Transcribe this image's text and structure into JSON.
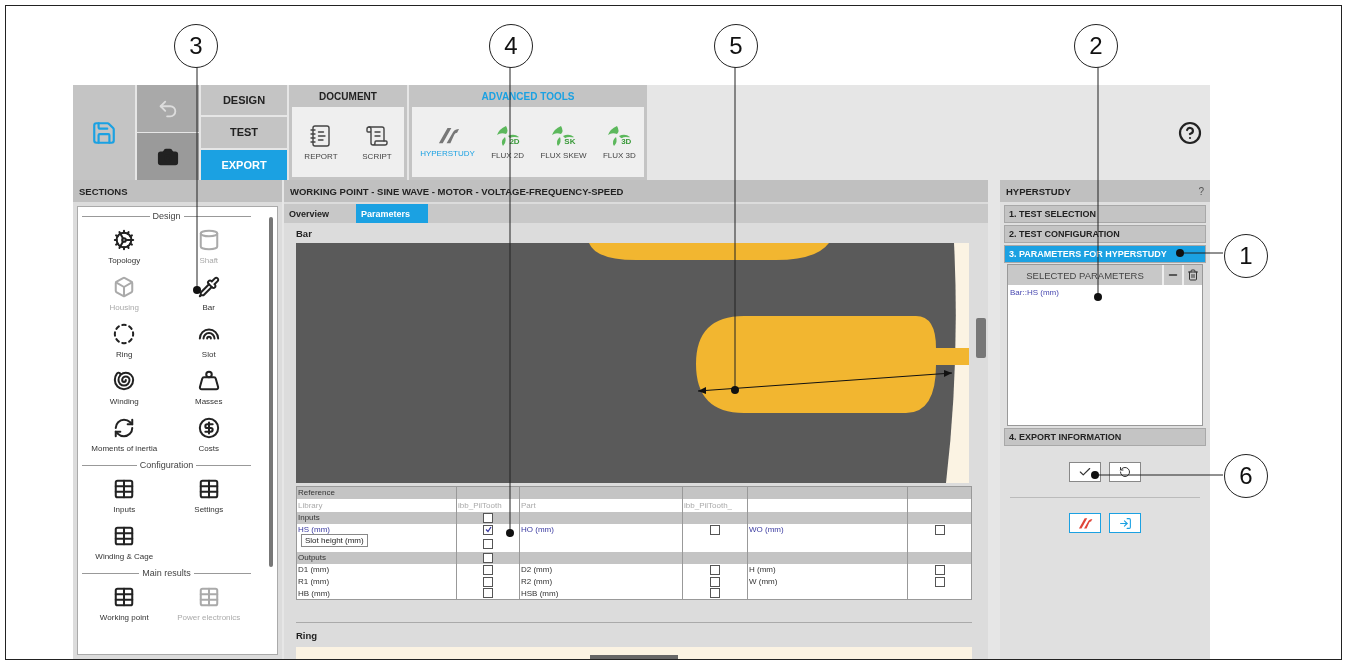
{
  "callouts": [
    {
      "label": "3"
    },
    {
      "label": "4"
    },
    {
      "label": "5"
    },
    {
      "label": "2"
    },
    {
      "label": "1"
    },
    {
      "label": "6"
    }
  ],
  "toolbar": {
    "modes": [
      {
        "label": "DESIGN",
        "selected": false
      },
      {
        "label": "TEST",
        "selected": false
      },
      {
        "label": "EXPORT",
        "selected": true
      }
    ],
    "document": {
      "title": "DOCUMENT",
      "tools": [
        {
          "label": "REPORT"
        },
        {
          "label": "SCRIPT"
        }
      ]
    },
    "advanced": {
      "title": "ADVANCED TOOLS",
      "tools": [
        {
          "kind": "hyperstudy",
          "label": "HYPERSTUDY",
          "selected": true
        },
        {
          "kind": "flux",
          "badge": "2D",
          "label": "FLUX 2D",
          "selected": false
        },
        {
          "kind": "flux",
          "badge": "SK",
          "label": "FLUX SKEW",
          "selected": false
        },
        {
          "kind": "flux",
          "badge": "3D",
          "label": "FLUX 3D",
          "selected": false
        }
      ]
    }
  },
  "sections": {
    "title": "SECTIONS",
    "groups": [
      {
        "title": "Design",
        "items": [
          {
            "label": "Topology",
            "disabled": false
          },
          {
            "label": "Shaft",
            "disabled": true
          },
          {
            "label": "Housing",
            "disabled": true
          },
          {
            "label": "Bar",
            "disabled": false
          },
          {
            "label": "Ring",
            "disabled": false
          },
          {
            "label": "Slot",
            "disabled": false
          },
          {
            "label": "Winding",
            "disabled": false
          },
          {
            "label": "Masses",
            "disabled": false
          },
          {
            "label": "Moments of inertia",
            "disabled": false
          },
          {
            "label": "Costs",
            "disabled": false
          }
        ]
      },
      {
        "title": "Configuration",
        "items": [
          {
            "label": "Inputs",
            "disabled": false
          },
          {
            "label": "Settings",
            "disabled": false
          },
          {
            "label": "Winding & Cage",
            "disabled": false
          }
        ]
      },
      {
        "title": "Main results",
        "items": [
          {
            "label": "Working point",
            "disabled": false
          },
          {
            "label": "Power electronics",
            "disabled": true
          }
        ]
      }
    ]
  },
  "working_point": {
    "title": "WORKING POINT - SINE WAVE - MOTOR - VOLTAGE-FREQUENCY-SPEED",
    "tabs": [
      {
        "label": "Overview",
        "selected": false
      },
      {
        "label": "Parameters",
        "selected": true
      }
    ],
    "panels": [
      {
        "title": "Bar"
      },
      {
        "title": "Ring"
      }
    ],
    "table": {
      "rows": [
        {
          "kind": "caption",
          "cells": [
            "Reference"
          ]
        },
        {
          "kind": "library",
          "cells": [
            "Library",
            "ibb_PilTooth",
            "Part",
            "ibb_PilTooth_"
          ]
        },
        {
          "kind": "group",
          "label": "Inputs",
          "checked": false
        },
        {
          "kind": "params",
          "linked": true,
          "params": [
            {
              "name": "HS (mm)",
              "checked": true
            },
            {
              "name": "HO (mm)",
              "checked": false
            },
            {
              "name": "WO (mm)",
              "checked": false
            }
          ]
        },
        {
          "kind": "params",
          "tooltip": "Slot height (mm)",
          "params": [
            {
              "checked": false
            }
          ]
        },
        {
          "kind": "group",
          "label": "Outputs",
          "checked": false
        },
        {
          "kind": "params",
          "linked": false,
          "params": [
            {
              "name": "D1 (mm)",
              "checked": false
            },
            {
              "name": "D2 (mm)",
              "checked": false
            },
            {
              "name": "H (mm)",
              "checked": false
            }
          ]
        },
        {
          "kind": "params",
          "linked": false,
          "params": [
            {
              "name": "R1 (mm)",
              "checked": false
            },
            {
              "name": "R2 (mm)",
              "checked": false
            },
            {
              "name": "W (mm)",
              "checked": false
            }
          ]
        },
        {
          "kind": "params",
          "linked": false,
          "params": [
            {
              "name": "HB (mm)",
              "checked": false
            },
            {
              "name": "HSB (mm)",
              "checked": false
            }
          ]
        }
      ]
    }
  },
  "hyperstudy": {
    "title": "HYPERSTUDY",
    "help": "?",
    "steps": [
      {
        "label": "1. TEST SELECTION",
        "selected": false
      },
      {
        "label": "2. TEST CONFIGURATION",
        "selected": false
      },
      {
        "label": "3. PARAMETERS FOR HYPERSTUDY",
        "selected": true
      },
      {
        "label": "4. EXPORT INFORMATION",
        "selected": false
      }
    ],
    "selected": {
      "title": "SELECTED PARAMETERS",
      "items": [
        "Bar::HS (mm)"
      ]
    }
  }
}
